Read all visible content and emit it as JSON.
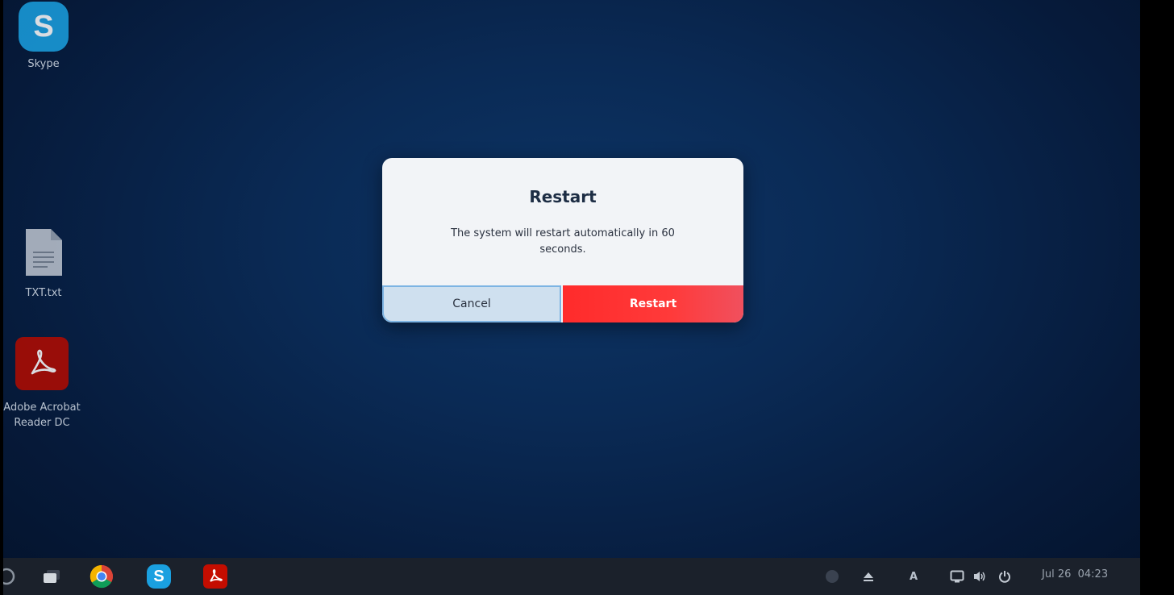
{
  "desktop": {
    "icons": [
      {
        "label": "Skype",
        "glyph": "S",
        "icon": "skype-icon"
      },
      {
        "label": "TXT.txt",
        "icon": "text-file-icon"
      },
      {
        "label_line1": "Adobe Acrobat",
        "label_line2": "Reader DC",
        "icon": "acrobat-reader-icon"
      }
    ]
  },
  "dialog": {
    "title": "Restart",
    "message": "The system will restart automatically in 60 seconds.",
    "cancel_label": "Cancel",
    "restart_label": "Restart",
    "colors": {
      "restart": "#ff2b2b",
      "cancel": "#cfe0ef",
      "cancel_border": "#7db4e3"
    }
  },
  "taskbar": {
    "apps": [
      "start-menu-icon",
      "show-desktop-icon",
      "chrome-icon",
      "skype-icon",
      "acrobat-reader-icon"
    ],
    "skype_glyph": "S",
    "tray": {
      "keyboard_layout": "A",
      "clock": "Jul 26  04:23",
      "icons": [
        "skype-tray-icon",
        "eject-icon",
        "keyboard-layout-indicator",
        "display-icon",
        "volume-icon",
        "power-icon"
      ]
    }
  }
}
